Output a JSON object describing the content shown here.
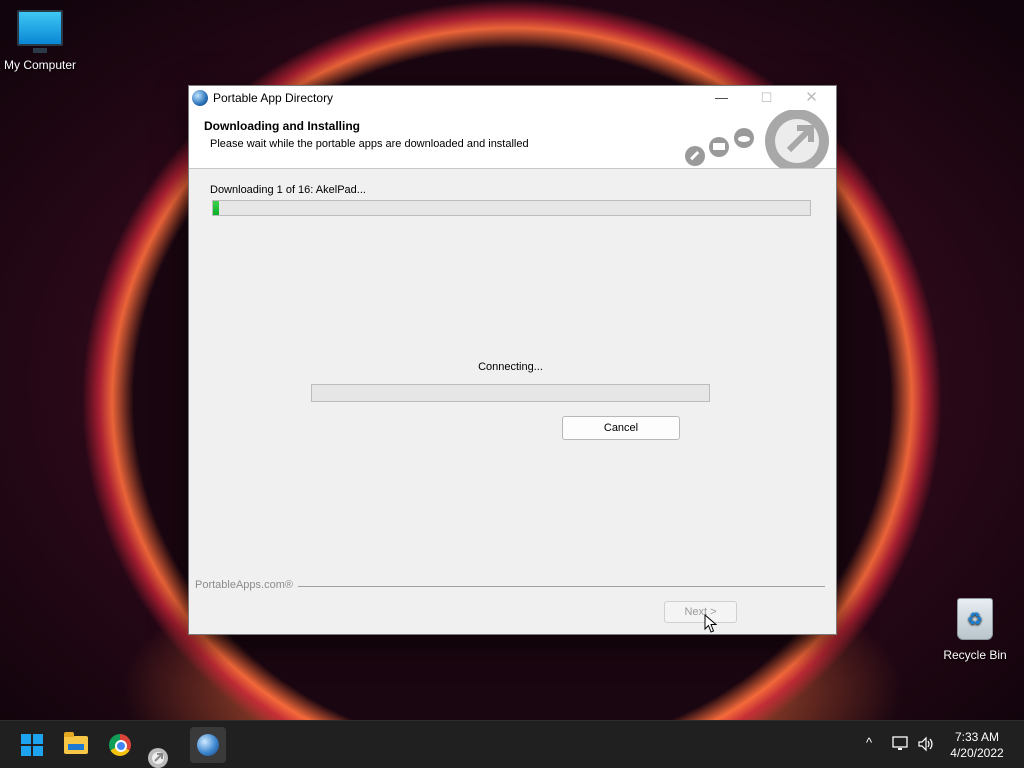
{
  "desktop": {
    "icons": [
      {
        "label": "My Computer"
      },
      {
        "label": "Recycle Bin"
      }
    ]
  },
  "window": {
    "title": "Portable App Directory",
    "controls": {
      "minimize": "—",
      "maximize": "☐",
      "close": "✕"
    },
    "header": {
      "title": "Downloading and Installing",
      "subtitle": "Please wait while the portable apps are downloaded and installed"
    },
    "overall_status": "Downloading 1 of 16: AkelPad...",
    "overall_progress": 0.01,
    "connection_status": "Connecting...",
    "file_progress": 0.0,
    "cancel_label": "Cancel",
    "brand": "PortableApps.com®",
    "next_label": "Next >"
  },
  "taskbar": {
    "tray_chevron": "^",
    "time": "7:33 AM",
    "date": "4/20/2022"
  },
  "colors": {
    "progress_fill": "#06b025",
    "start_accent": "#1ea3f0"
  }
}
